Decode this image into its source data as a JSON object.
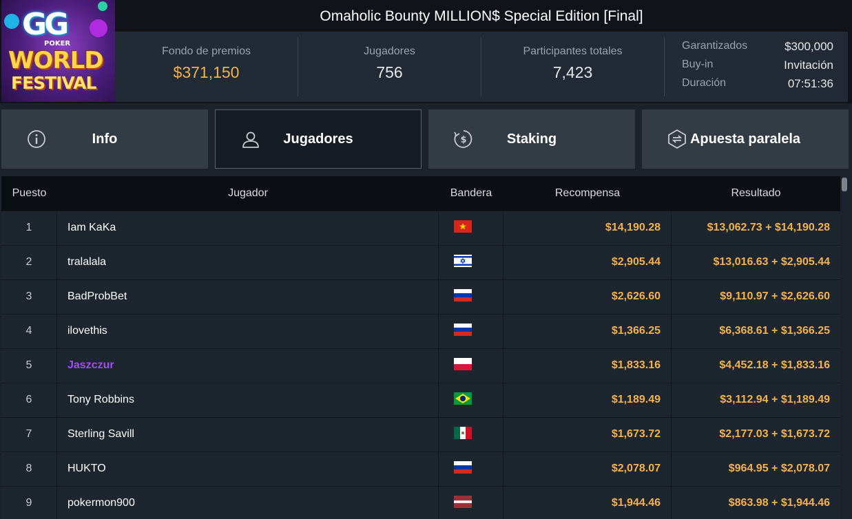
{
  "header": {
    "title": "Omaholic Bounty MILLION$ Special Edition [Final]",
    "logo": {
      "gg": "GG",
      "poker": "POKER",
      "world": "WORLD",
      "festival": "FESTIVAL"
    },
    "stats": [
      {
        "label": "Fondo de premios",
        "value": "$371,150"
      },
      {
        "label": "Jugadores",
        "value": "756"
      },
      {
        "label": "Participantes totales",
        "value": "7,423"
      }
    ],
    "details": [
      {
        "key": "Garantizados",
        "value": "$300,000"
      },
      {
        "key": "Buy-in",
        "value": "Invitación"
      },
      {
        "key": "Duración",
        "value": "07:51:36"
      }
    ]
  },
  "tabs": [
    {
      "label": "Info",
      "icon": "info-icon"
    },
    {
      "label": "Jugadores",
      "icon": "user-icon",
      "active": true
    },
    {
      "label": "Staking",
      "icon": "staking-dollar-icon"
    },
    {
      "label": "Apuesta paralela",
      "icon": "side-bet-icon"
    }
  ],
  "table": {
    "columns": [
      "Puesto",
      "Jugador",
      "Bandera",
      "Recompensa",
      "Resultado"
    ],
    "rows": [
      {
        "pos": "1",
        "player": "Iam KaKa",
        "flag": "vietnam",
        "reward": "$14,190.28",
        "result": "$13,062.73 + $14,190.28"
      },
      {
        "pos": "2",
        "player": "tralalala",
        "flag": "israel",
        "reward": "$2,905.44",
        "result": "$13,016.63 + $2,905.44"
      },
      {
        "pos": "3",
        "player": "BadProbBet",
        "flag": "russia",
        "reward": "$2,626.60",
        "result": "$9,110.97 + $2,626.60"
      },
      {
        "pos": "4",
        "player": "ilovethis",
        "flag": "russia",
        "reward": "$1,366.25",
        "result": "$6,368.61 + $1,366.25"
      },
      {
        "pos": "5",
        "player": "Jaszczur",
        "flag": "poland",
        "reward": "$1,833.16",
        "result": "$4,452.18 + $1,833.16",
        "highlight": true
      },
      {
        "pos": "6",
        "player": "Tony Robbins",
        "flag": "brazil",
        "reward": "$1,189.49",
        "result": "$3,112.94 + $1,189.49"
      },
      {
        "pos": "7",
        "player": "Sterling Savill",
        "flag": "mexico",
        "reward": "$1,673.72",
        "result": "$2,177.03 + $1,673.72"
      },
      {
        "pos": "8",
        "player": "HUKTO",
        "flag": "russia",
        "reward": "$2,078.07",
        "result": "$964.95 + $2,078.07"
      },
      {
        "pos": "9",
        "player": "pokermon900",
        "flag": "latvia",
        "reward": "$1,944.46",
        "result": "$863.98 + $1,944.46"
      }
    ]
  },
  "colors": {
    "accent_gold": "#f3b24a",
    "highlight_purple": "#a24cff",
    "header_bg": "#10141a"
  }
}
